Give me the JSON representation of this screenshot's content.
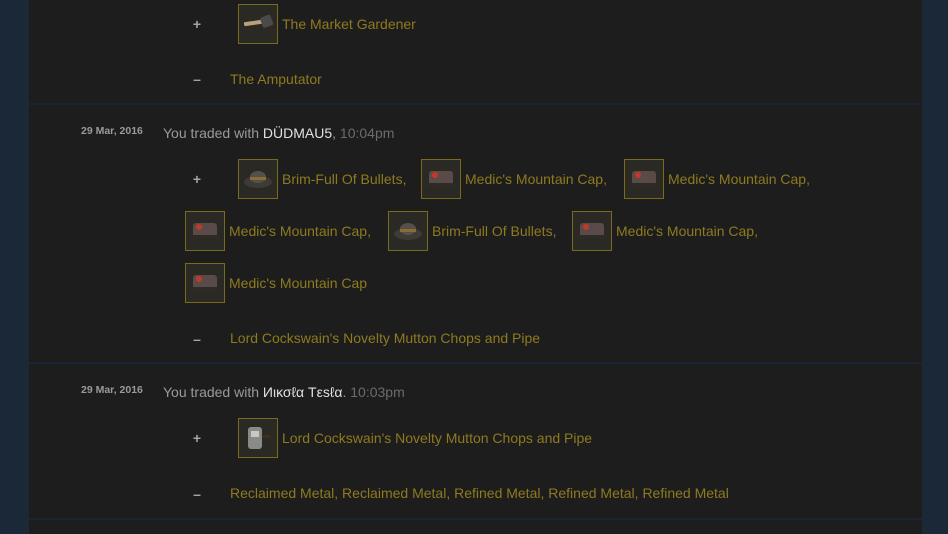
{
  "entries": [
    {
      "received": [
        {
          "name": "The Market Gardener",
          "icon": "market-gardener-icon"
        }
      ],
      "given": [
        "The Amputator"
      ]
    },
    {
      "date": "29 Mar, 2016",
      "prefix": "You traded with ",
      "user": "DÜDMAU5",
      "time": "10:04pm",
      "received": [
        {
          "name": "Brim-Full Of Bullets",
          "icon": "brim-full-hat-icon"
        },
        {
          "name": "Medic's Mountain Cap",
          "icon": "mountain-cap-icon"
        },
        {
          "name": "Medic's Mountain Cap",
          "icon": "mountain-cap-icon"
        },
        {
          "name": "Medic's Mountain Cap",
          "icon": "mountain-cap-icon"
        },
        {
          "name": "Brim-Full Of Bullets",
          "icon": "brim-full-hat-icon"
        },
        {
          "name": "Medic's Mountain Cap",
          "icon": "mountain-cap-icon"
        },
        {
          "name": "Medic's Mountain Cap",
          "icon": "mountain-cap-icon"
        }
      ],
      "given": [
        "Lord Cockswain's Novelty Mutton Chops and Pipe"
      ]
    },
    {
      "date": "29 Mar, 2016",
      "prefix": "You traded with ",
      "user": "Иικσℓα Тεѕℓα",
      "time": "10:03pm",
      "received": [
        {
          "name": "Lord Cockswain's Novelty Mutton Chops and Pipe",
          "icon": "mutton-chops-icon"
        }
      ],
      "given": [
        "Reclaimed Metal",
        "Reclaimed Metal",
        "Refined Metal",
        "Refined Metal",
        "Refined Metal"
      ]
    }
  ],
  "symbols": {
    "plus": "+",
    "minus": "–",
    "comma": ",",
    "period": "."
  },
  "colors": {
    "item_link": "#8e7a1f",
    "background": "#1d1d1d",
    "page": "#1b2838"
  }
}
